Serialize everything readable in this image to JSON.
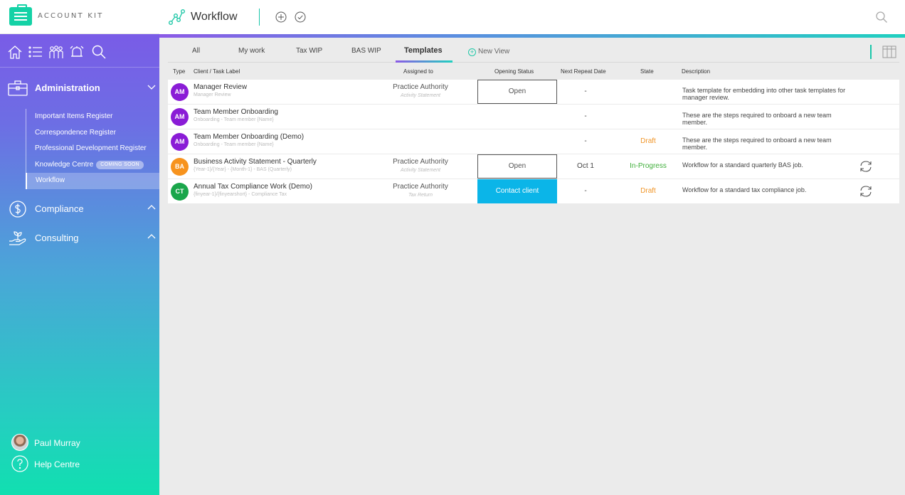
{
  "brand": {
    "name": "ACCOUNT KIT",
    "accent": "#14d2a6"
  },
  "header": {
    "title": "Workflow",
    "icons": [
      "workflow-icon",
      "add-icon",
      "check-icon",
      "search-icon"
    ]
  },
  "sidebar": {
    "quick_icons": [
      "home-icon",
      "list-icon",
      "people-icon",
      "alarm-icon",
      "search-icon"
    ],
    "sections": [
      {
        "label": "Administration",
        "icon": "briefcase-icon",
        "expanded": true
      },
      {
        "label": "Compliance",
        "icon": "dollar-icon",
        "expanded": false
      },
      {
        "label": "Consulting",
        "icon": "plant-hand-icon",
        "expanded": false
      }
    ],
    "admin_items": [
      {
        "label": "Important Items Register"
      },
      {
        "label": "Correspondence Register"
      },
      {
        "label": "Professional Development Register"
      },
      {
        "label": "Knowledge Centre",
        "badge": "COMING SOON"
      },
      {
        "label": "Workflow",
        "active": true
      }
    ],
    "user": {
      "name": "Paul Murray"
    },
    "help": {
      "label": "Help Centre"
    }
  },
  "tabs": {
    "items": [
      "All",
      "My work",
      "Tax WIP",
      "BAS WIP",
      "Templates"
    ],
    "active": "Templates",
    "new_view": "New View"
  },
  "table": {
    "columns": [
      "Type",
      "Client / Task Label",
      "Assigned to",
      "Opening Status",
      "Next Repeat Date",
      "State",
      "Description"
    ],
    "rows": [
      {
        "type": "AM",
        "type_color": "#8a1cd6",
        "title": "Manager Review",
        "subtitle": "Manager Review",
        "assigned": "Practice Authority",
        "assigned_sub": "Activity Statement",
        "status": "Open",
        "repeat": "-",
        "state": "",
        "state_color": "",
        "description": "Task template for embedding into other task templates for manager review.",
        "sync": false
      },
      {
        "type": "AM",
        "type_color": "#8a1cd6",
        "title": "Team Member Onboarding",
        "subtitle": "Onboarding - Team member {Name}",
        "assigned": "",
        "assigned_sub": "",
        "status": "",
        "repeat": "-",
        "state": "",
        "state_color": "",
        "description": "These are the steps required to onboard a new team member.",
        "sync": false
      },
      {
        "type": "AM",
        "type_color": "#8a1cd6",
        "title": "Team Member Onboarding (Demo)",
        "subtitle": "Onboarding - Team member {Name}",
        "assigned": "",
        "assigned_sub": "",
        "status": "",
        "repeat": "-",
        "state": "Draft",
        "state_color": "#f0962a",
        "description": "These are the steps required to onboard a new team member.",
        "sync": false
      },
      {
        "type": "BA",
        "type_color": "#f7931e",
        "title": "Business Activity Statement - Quarterly",
        "subtitle": "{Year-1}/{Year} - {Month-1} - BAS (Quarterly)",
        "assigned": "Practice Authority",
        "assigned_sub": "Activity Statement",
        "status": "Open",
        "repeat": "Oct 1",
        "state": "In-Progress",
        "state_color": "#3fae3a",
        "description": "Workflow for a standard quarterly BAS job.",
        "sync": true
      },
      {
        "type": "CT",
        "type_color": "#1aa64b",
        "title": "Annual Tax Compliance Work (Demo)",
        "subtitle": "{finyear-1}/{finyearshort} - Compliance Tax",
        "assigned": "Practice Authority",
        "assigned_sub": "Tax Return",
        "status": "Contact client",
        "status_style": "blue",
        "repeat": "-",
        "state": "Draft",
        "state_color": "#f0962a",
        "description": "Workflow for a standard tax compliance job.",
        "sync": true
      }
    ]
  }
}
